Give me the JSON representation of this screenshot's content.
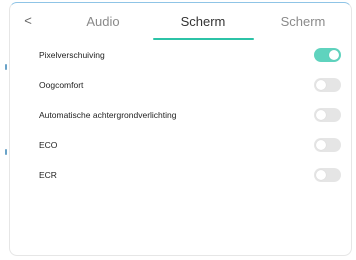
{
  "tabs": {
    "back_glyph": "<",
    "items": [
      {
        "label": "Audio",
        "active": false
      },
      {
        "label": "Scherm",
        "active": true
      },
      {
        "label": "Scherm",
        "active": false
      }
    ]
  },
  "settings": [
    {
      "label": "Pixelverschuiving",
      "enabled": true
    },
    {
      "label": "Oogcomfort",
      "enabled": false
    },
    {
      "label": "Automatische achtergrondverlichting",
      "enabled": false
    },
    {
      "label": "ECO",
      "enabled": false
    },
    {
      "label": "ECR",
      "enabled": false
    }
  ],
  "colors": {
    "accent": "#2cc3a7",
    "toggle_on": "#5fd3be",
    "toggle_off": "#e5e5e5"
  }
}
